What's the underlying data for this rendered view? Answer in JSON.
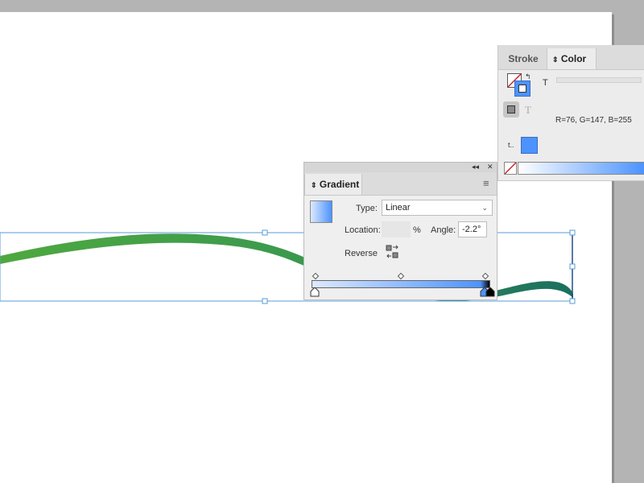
{
  "color_panel": {
    "tabs": [
      {
        "label": "Stroke",
        "active": false
      },
      {
        "label": "Color",
        "active": true
      }
    ],
    "tab_arrows": "⇕",
    "tint_label": "T",
    "tint_label2": "T",
    "rgb_readout": "R=76, G=147, B=255",
    "swatch_color": "#4c93ff",
    "small_label": "t..",
    "icons": [
      "none-stroke-icon",
      "fill-swatch-icon",
      "swap-icon",
      "apply-color-icon",
      "text-t-icon",
      "color-ramp"
    ]
  },
  "gradient_panel": {
    "tab_label": "Gradient",
    "tab_arrows": "⇕",
    "type_label": "Type:",
    "type_value": "Linear",
    "location_label": "Location:",
    "location_value": "",
    "location_unit": "%",
    "angle_label": "Angle:",
    "angle_value": "-2.2°",
    "reverse_label": "Reverse",
    "gradient_start": "#dde9ff",
    "gradient_end": "#4c93ff",
    "stop_end_color": "#000000",
    "collapse_icon": "◂◂",
    "close_icon": "✕",
    "menu_icon": "≡"
  },
  "artwork": {
    "stroke_colors": [
      "#4ea83f",
      "#3b9a4e",
      "#1b6f5f"
    ],
    "frame_color": "#5a9bd5"
  }
}
